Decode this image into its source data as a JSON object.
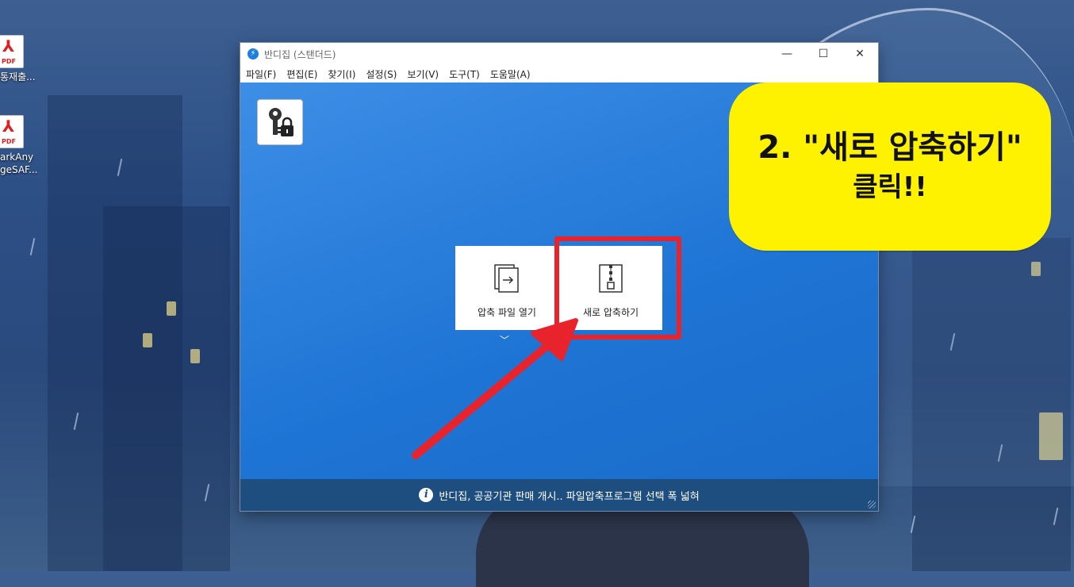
{
  "desktop": {
    "icons": [
      {
        "label_lines": [
          "통재출..."
        ],
        "icon": "pdf-file-icon",
        "badge": "PDF"
      },
      {
        "label_lines": [
          "arkAny",
          "geSAF..."
        ],
        "icon": "pdf-file-icon",
        "badge": "PDF"
      }
    ]
  },
  "window": {
    "title": "반디집 (스탠더드)",
    "controls": {
      "minimize": "—",
      "maximize": "☐",
      "close": "✕"
    },
    "menu": [
      "파일(F)",
      "편집(E)",
      "찾기(I)",
      "설정(S)",
      "보기(V)",
      "도구(T)",
      "도움말(A)"
    ],
    "actions": {
      "open_archive": "압축 파일 열기",
      "new_archive": "새로 압축하기"
    },
    "status": "반디집, 공공기관 판매 개시.. 파일압축프로그램 선택 폭 넓혀"
  },
  "annotation": {
    "line1": "2. \"새로 압축하기\"",
    "line2": "클릭!!",
    "callout_color": "#fff200",
    "highlight_color": "#e8232c"
  }
}
